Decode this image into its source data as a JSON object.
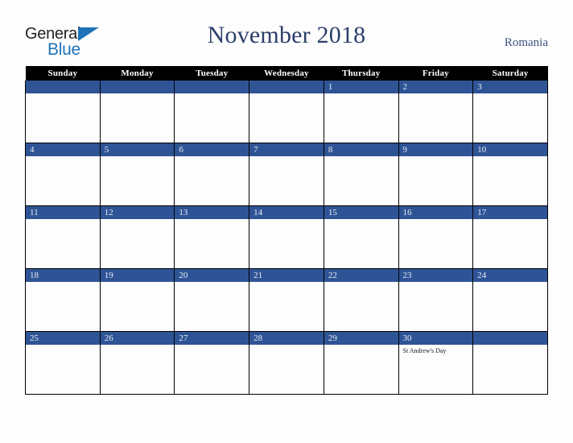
{
  "brand": {
    "name_part1": "General",
    "name_part2": "Blue",
    "triangle_icon": "triangle-icon",
    "color_dark": "#231f20",
    "color_blue": "#1f73b8"
  },
  "header": {
    "title": "November 2018",
    "country": "Romania",
    "title_color": "#2c3e6b",
    "country_color": "#3b5282"
  },
  "calendar": {
    "accent_color": "#2f5496",
    "header_bg": "#000000",
    "header_fg": "#ffffff",
    "border_color": "#000000",
    "weekdays": [
      "Sunday",
      "Monday",
      "Tuesday",
      "Wednesday",
      "Thursday",
      "Friday",
      "Saturday"
    ],
    "weeks": [
      [
        {
          "day": "",
          "events": []
        },
        {
          "day": "",
          "events": []
        },
        {
          "day": "",
          "events": []
        },
        {
          "day": "",
          "events": []
        },
        {
          "day": "1",
          "events": []
        },
        {
          "day": "2",
          "events": []
        },
        {
          "day": "3",
          "events": []
        }
      ],
      [
        {
          "day": "4",
          "events": []
        },
        {
          "day": "5",
          "events": []
        },
        {
          "day": "6",
          "events": []
        },
        {
          "day": "7",
          "events": []
        },
        {
          "day": "8",
          "events": []
        },
        {
          "day": "9",
          "events": []
        },
        {
          "day": "10",
          "events": []
        }
      ],
      [
        {
          "day": "11",
          "events": []
        },
        {
          "day": "12",
          "events": []
        },
        {
          "day": "13",
          "events": []
        },
        {
          "day": "14",
          "events": []
        },
        {
          "day": "15",
          "events": []
        },
        {
          "day": "16",
          "events": []
        },
        {
          "day": "17",
          "events": []
        }
      ],
      [
        {
          "day": "18",
          "events": []
        },
        {
          "day": "19",
          "events": []
        },
        {
          "day": "20",
          "events": []
        },
        {
          "day": "21",
          "events": []
        },
        {
          "day": "22",
          "events": []
        },
        {
          "day": "23",
          "events": []
        },
        {
          "day": "24",
          "events": []
        }
      ],
      [
        {
          "day": "25",
          "events": []
        },
        {
          "day": "26",
          "events": []
        },
        {
          "day": "27",
          "events": []
        },
        {
          "day": "28",
          "events": []
        },
        {
          "day": "29",
          "events": []
        },
        {
          "day": "30",
          "events": [
            "St Andrew's Day"
          ]
        },
        {
          "day": "",
          "events": []
        }
      ]
    ]
  }
}
